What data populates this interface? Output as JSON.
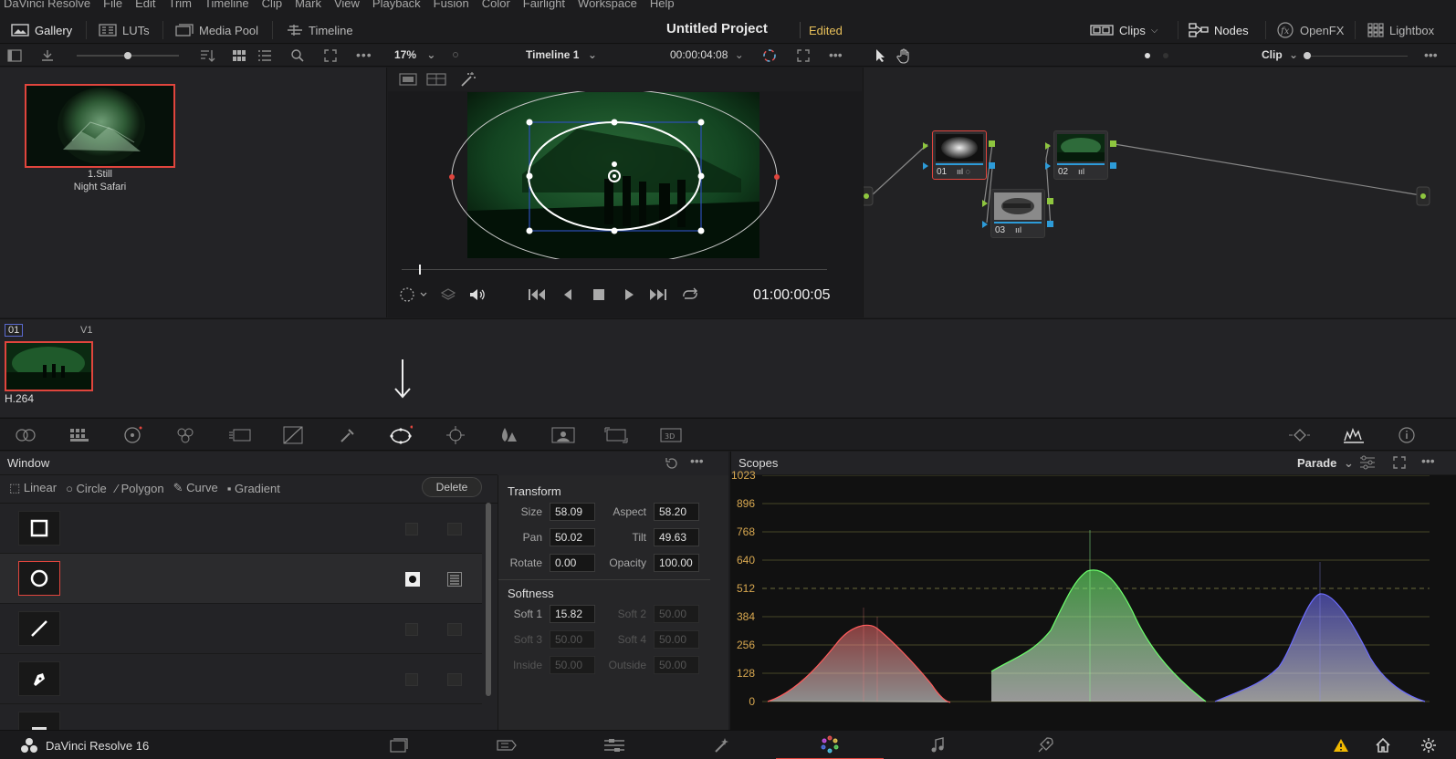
{
  "menubar": [
    "DaVinci Resolve",
    "File",
    "Edit",
    "Trim",
    "Timeline",
    "Clip",
    "Mark",
    "View",
    "Playback",
    "Fusion",
    "Color",
    "Fairlight",
    "Workspace",
    "Help"
  ],
  "topbar": {
    "gallery": "Gallery",
    "luts": "LUTs",
    "media_pool": "Media Pool",
    "timeline": "Timeline",
    "project_title": "Untitled Project",
    "status": "Edited",
    "clips": "Clips",
    "nodes": "Nodes",
    "openfx": "OpenFX",
    "lightbox": "Lightbox"
  },
  "viewer": {
    "zoom": "17%",
    "timeline_name": "Timeline 1",
    "source_tc": "00:00:04:08",
    "record_tc": "01:00:00:05"
  },
  "node_editor": {
    "mode": "Clip",
    "nodes": [
      {
        "id": "01"
      },
      {
        "id": "02"
      },
      {
        "id": "03"
      }
    ]
  },
  "gallery": {
    "still_label": "1.Still",
    "still_name": "Night Safari"
  },
  "clips": {
    "clip_number": "01",
    "track": "V1",
    "codec": "H.264"
  },
  "window_panel": {
    "title": "Window",
    "tools": [
      "Linear",
      "Circle",
      "Polygon",
      "Curve",
      "Gradient"
    ],
    "delete": "Delete",
    "transform_title": "Transform",
    "transform": {
      "size_label": "Size",
      "size": "58.09",
      "aspect_label": "Aspect",
      "aspect": "58.20",
      "pan_label": "Pan",
      "pan": "50.02",
      "tilt_label": "Tilt",
      "tilt": "49.63",
      "rotate_label": "Rotate",
      "rotate": "0.00",
      "opacity_label": "Opacity",
      "opacity": "100.00"
    },
    "softness_title": "Softness",
    "softness": {
      "soft1_label": "Soft 1",
      "soft1": "15.82",
      "soft2_label": "Soft 2",
      "soft2": "50.00",
      "soft3_label": "Soft 3",
      "soft3": "50.00",
      "soft4_label": "Soft 4",
      "soft4": "50.00",
      "inside_label": "Inside",
      "inside": "50.00",
      "outside_label": "Outside",
      "outside": "50.00"
    }
  },
  "scopes": {
    "title": "Scopes",
    "mode": "Parade",
    "scale": [
      "1023",
      "896",
      "768",
      "640",
      "512",
      "384",
      "256",
      "128",
      "0"
    ]
  },
  "bottombar": {
    "app_name": "DaVinci Resolve 16"
  },
  "colors": {
    "accent_red": "#e0453d",
    "edited_yellow": "#e8c05a",
    "node_green": "#8ec63f",
    "node_blue": "#2d9bd8"
  }
}
